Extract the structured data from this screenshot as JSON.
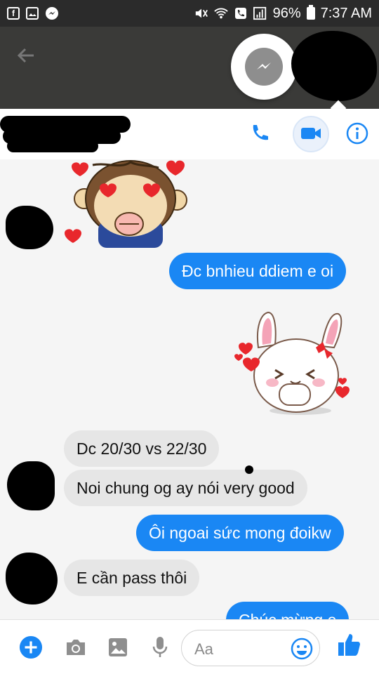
{
  "status_bar": {
    "battery": "96%",
    "time": "7:37 AM",
    "left_icons": [
      "facebook-icon",
      "gallery-icon",
      "messenger-icon"
    ],
    "right_icons": [
      "mute-icon",
      "wifi-icon",
      "call-icon",
      "signal-icon"
    ]
  },
  "header": {
    "actions": [
      "phone-icon",
      "video-call-icon",
      "info-icon"
    ]
  },
  "messages": [
    {
      "side": "in",
      "type": "sticker",
      "name": "monkey-heart-eyes-sticker"
    },
    {
      "side": "out",
      "type": "text",
      "text": "Đc bnhieu ddiem e oi"
    },
    {
      "side": "out",
      "type": "sticker",
      "name": "bunny-love-sticker"
    },
    {
      "side": "in",
      "type": "text",
      "text": "Dc 20/30  vs 22/30"
    },
    {
      "side": "in",
      "type": "text",
      "text": "Noi chung og ay nói very good"
    },
    {
      "side": "out",
      "type": "text",
      "text": "Ôi ngoai sức mong đoikw"
    },
    {
      "side": "in",
      "type": "text",
      "text": "E cần pass thôi"
    },
    {
      "side": "out",
      "type": "text",
      "text": "Chúc mừng e"
    }
  ],
  "composer": {
    "placeholder": "Aa",
    "icons": [
      "plus-icon",
      "camera-icon",
      "image-icon",
      "microphone-icon",
      "emoji-icon",
      "thumbs-up-icon"
    ]
  },
  "colors": {
    "accent": "#1a87f4",
    "incoming_bubble": "#e6e6e6",
    "header_dark": "#3a3a38"
  }
}
